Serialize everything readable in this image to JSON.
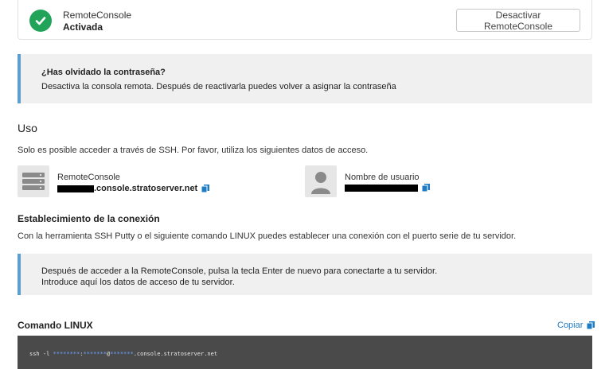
{
  "status": {
    "title": "RemoteConsole",
    "state": "Activada",
    "deactivate_label": "Desactivar RemoteConsole"
  },
  "forgot": {
    "title": "¿Has olvidado la contraseña?",
    "text": "Desactiva la consola remota. Después de reactivarla puedes volver a asignar la contraseña"
  },
  "usage": {
    "heading": "Uso",
    "intro": "Solo es posible acceder a través de SSH. Por favor, utiliza los siguientes datos de acceso.",
    "host": {
      "label": "RemoteConsole",
      "value": ".console.stratoserver.net"
    },
    "user": {
      "label": "Nombre de usuario"
    }
  },
  "connection": {
    "heading": "Establecimiento de la conexión",
    "text": "Con la herramienta SSH Putty o el siguiente comando LINUX puedes establecer una conexión con el puerto serie de tu servidor."
  },
  "hint": {
    "line1": "Después de acceder a la RemoteConsole, pulsa la tecla Enter de nuevo para conectarte a tu servidor.",
    "line2": "Introduce aquí los datos de acceso de tu servidor."
  },
  "command": {
    "heading": "Comando LINUX",
    "copy_label": "Copiar",
    "prefix": "ssh -l ",
    "mask1": "********",
    "sep1": ":",
    "mask2": "*******",
    "sep2": "@",
    "mask3": "*******",
    "suffix": ".console.stratoserver.net"
  },
  "colors": {
    "success": "#21a35a",
    "accent": "#5b9fd1",
    "link": "#1e7bc4",
    "code_bg": "#4a4a4a"
  }
}
